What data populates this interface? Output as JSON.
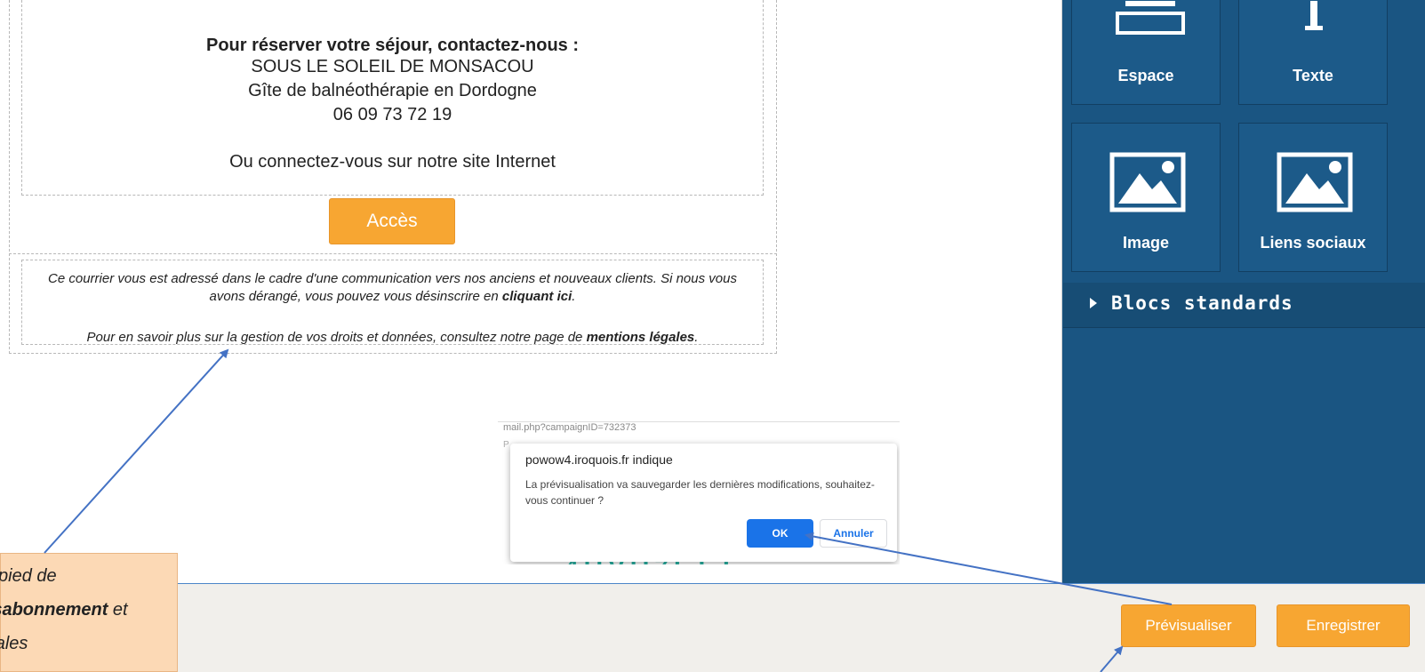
{
  "email": {
    "contact_title": "Pour réserver votre séjour, contactez-nous :",
    "company": "SOUS LE SOLEIL DE MONSACOU",
    "subtitle": "Gîte de balnéothérapie en Dordogne",
    "phone": "06 09 73 72 19",
    "website_line": "Ou connectez-vous sur notre site Internet",
    "access_button": "Accès",
    "footer": {
      "p1_text": "Ce courrier vous est adressé dans le cadre d'une communication vers nos anciens et nouveaux clients. Si nous vous avons dérangé, vous pouvez vous désinscrire en ",
      "p1_link": "cliquant ici",
      "p1_end": ".",
      "p2_text": "Pour en savoir plus sur la gestion de vos droits et données, consultez notre page de ",
      "p2_link": "mentions légales",
      "p2_end": "."
    }
  },
  "sidebar": {
    "tiles": [
      {
        "label": "Espace",
        "icon": "spacer-icon"
      },
      {
        "label": "Texte",
        "icon": "text-icon"
      },
      {
        "label": "Image",
        "icon": "image-icon"
      },
      {
        "label": "Liens sociaux",
        "icon": "image-icon"
      }
    ],
    "section_label": "Blocs standards"
  },
  "dialog": {
    "url_fragment": "mail.php?campaignID=732373",
    "title": "powow4.iroquois.fr indique",
    "message": "La prévisualisation va sauvegarder les dernières modifications, souhaitez-vous continuer ?",
    "ok_label": "OK",
    "cancel_label": "Annuler",
    "bg_letter": "P",
    "bg_digits": "4IIVII7I I I"
  },
  "bottom": {
    "preview_label": "Prévisualiser",
    "save_label": "Enregistrer"
  },
  "annotation": {
    "line1": "En pied de",
    "line2_bold": "désabonnement",
    "line2_rest": " et",
    "line3": "légales"
  },
  "colors": {
    "accent_orange": "#f7a632",
    "sidebar_blue": "#1a5582",
    "dialog_blue": "#1a73e8",
    "annotation_bg": "#fcd9b5",
    "arrow_blue": "#4472c4"
  }
}
